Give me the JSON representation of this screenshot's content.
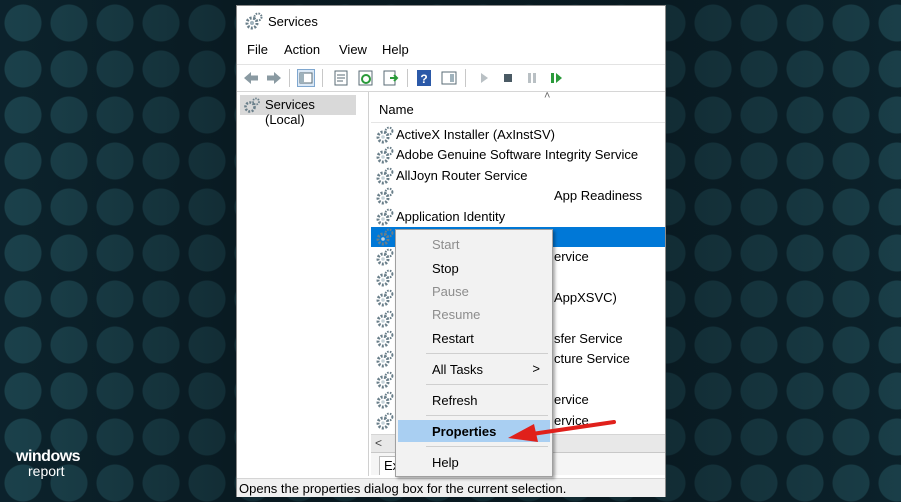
{
  "window": {
    "title": "Services"
  },
  "menu": [
    "File",
    "Action",
    "View",
    "Help"
  ],
  "tree": {
    "root": "Services (Local)"
  },
  "list": {
    "column": "Name",
    "rows": [
      "ActiveX Installer (AxInstSV)",
      "Adobe Genuine Software Integrity Service",
      "AllJoyn Router Service",
      "App Readiness",
      "Application Identity",
      "",
      "ervice",
      "",
      "AppXSVC)",
      "",
      "sfer Service",
      "cture Service",
      "",
      "ervice",
      "ervice"
    ],
    "selected_index": 5
  },
  "tabs": {
    "extended": "Ex"
  },
  "status": "Opens the properties dialog box for the current selection.",
  "context_menu": {
    "items": [
      {
        "label": "Start",
        "disabled": true
      },
      {
        "label": "Stop",
        "disabled": false
      },
      {
        "label": "Pause",
        "disabled": true
      },
      {
        "label": "Resume",
        "disabled": true
      },
      {
        "label": "Restart",
        "disabled": false
      },
      {
        "label": "All Tasks",
        "disabled": false
      },
      {
        "label": "Refresh",
        "disabled": false
      },
      {
        "label": "Properties",
        "disabled": false
      },
      {
        "label": "Help",
        "disabled": false
      }
    ],
    "submenu_glyph": ">",
    "highlighted": "Properties"
  },
  "logo": {
    "line1": "windows",
    "line2": "report"
  },
  "colors": {
    "selection": "#0078d7",
    "menu_highlight": "#a9cff2",
    "arrow": "#e0201b"
  }
}
